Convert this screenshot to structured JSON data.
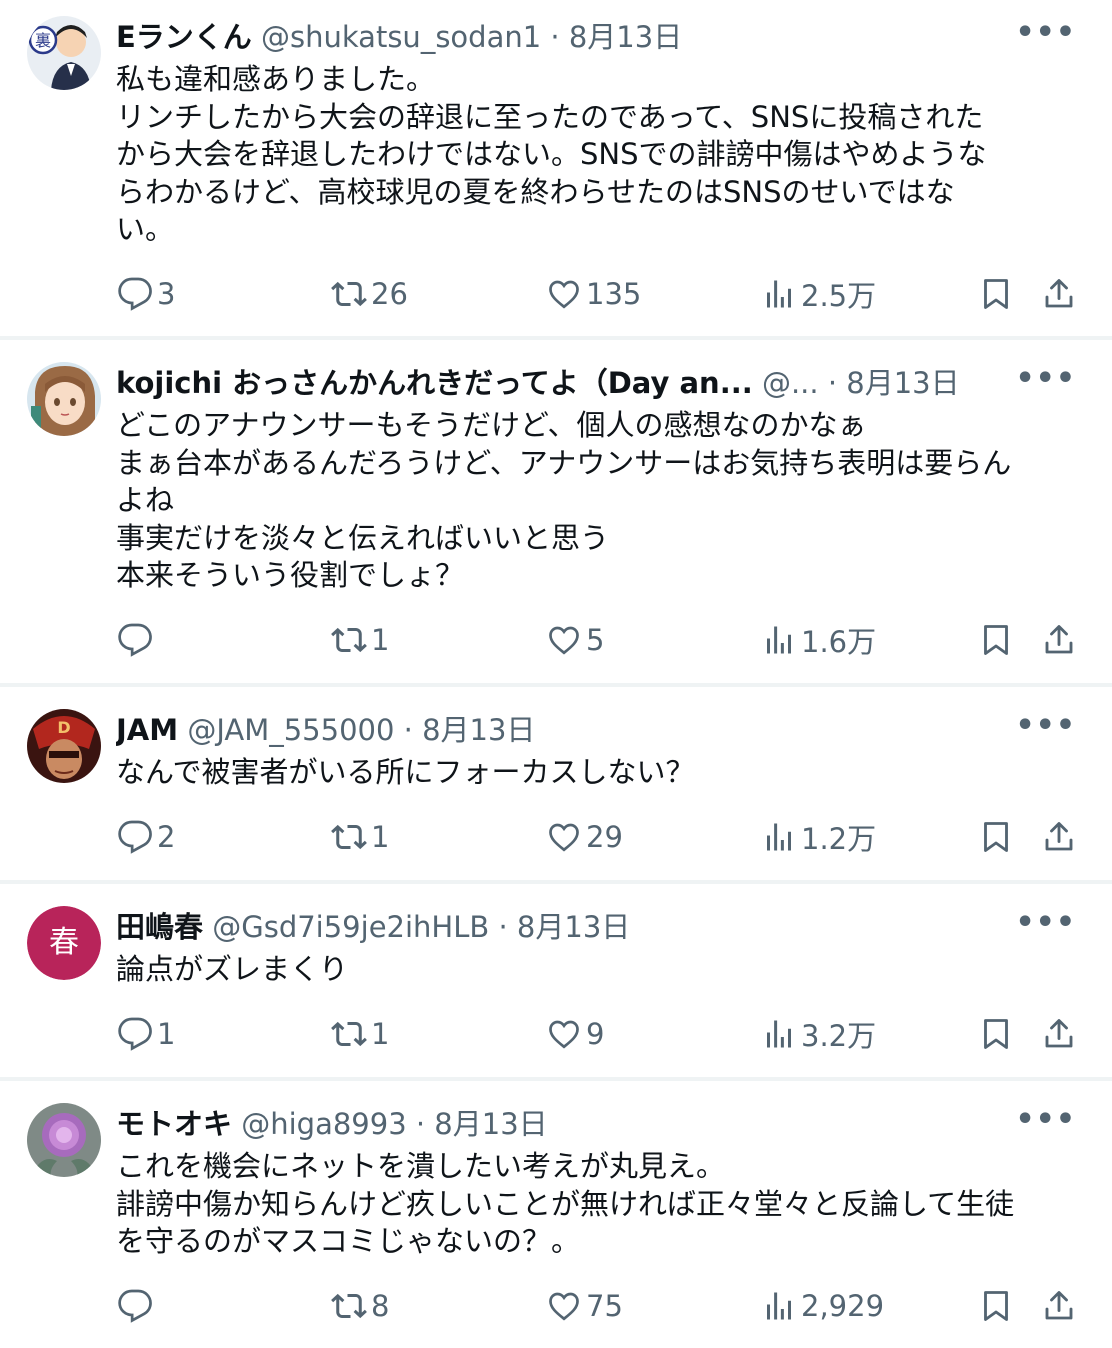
{
  "tweets": [
    {
      "name": "Eランくん",
      "handle": "@shukatsu_sodan1",
      "date": "· 8月13日",
      "lines": [
        "私も違和感ありました。",
        "リンチしたから大会の辞退に至ったのであって、SNSに投稿された",
        "から大会を辞退したわけではない。SNSでの誹謗中傷はやめような",
        "らわかるけど、高校球児の夏を終わらせたのはSNSのせいではな",
        "い。"
      ],
      "replies": "3",
      "retweets": "26",
      "likes": "135",
      "views": "2.5万"
    },
    {
      "name": "kojichi おっさんかんれきだってよ（Day an...",
      "handle": "@...",
      "date": "· 8月13日",
      "lines": [
        "どこのアナウンサーもそうだけど、個人の感想なのかなぁ",
        "まぁ台本があるんだろうけど、アナウンサーはお気持ち表明は要らん",
        "よね",
        "事実だけを淡々と伝えればいいと思う",
        "本来そういう役割でしょ？"
      ],
      "replies": "",
      "retweets": "1",
      "likes": "5",
      "views": "1.6万"
    },
    {
      "name": "JAM",
      "handle": "@JAM_555000",
      "date": "· 8月13日",
      "lines": [
        "なんで被害者がいる所にフォーカスしない？"
      ],
      "replies": "2",
      "retweets": "1",
      "likes": "29",
      "views": "1.2万"
    },
    {
      "name": "田嶋春",
      "handle": "@Gsd7i59je2ihHLB",
      "date": "· 8月13日",
      "avatar_letter": "春",
      "lines": [
        "論点がズレまくり"
      ],
      "replies": "1",
      "retweets": "1",
      "likes": "9",
      "views": "3.2万"
    },
    {
      "name": "モトオキ",
      "handle": "@higa8993",
      "date": "· 8月13日",
      "lines": [
        "これを機会にネットを潰したい考えが丸見え。",
        "誹謗中傷か知らんけど疚しいことが無ければ正々堂々と反論して生徒",
        "を守るのがマスコミじゃないの？。"
      ],
      "replies": "",
      "retweets": "8",
      "likes": "75",
      "views": "2,929"
    }
  ],
  "colors": {
    "text": "#0f1419",
    "secondary": "#536471",
    "divider": "#eff3f4",
    "avatar_bg_4": "#b8245a"
  },
  "icons": [
    "more-icon",
    "reply-icon",
    "retweet-icon",
    "like-icon",
    "views-icon",
    "bookmark-icon",
    "share-icon"
  ]
}
